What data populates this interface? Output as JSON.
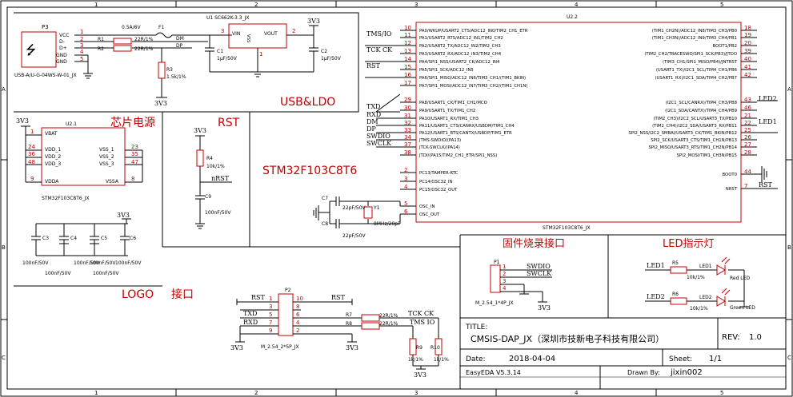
{
  "border": {
    "col_markers": [
      "1",
      "2",
      "3",
      "4",
      "5"
    ],
    "row_markers": [
      "A",
      "B",
      "C"
    ]
  },
  "usb": {
    "connector_ref": "P3",
    "connector_part": "USB-A/U-G-04WS-W-01_JX",
    "pins": [
      "VCC",
      "D-",
      "D+",
      "GND",
      "GND"
    ],
    "pin_numbers": [
      "1",
      "2",
      "3",
      "4",
      "5"
    ],
    "fuse_ref": "F1",
    "fuse_value": "0.5A/6V",
    "r1_ref": "R1",
    "r1_value": "22R/1%",
    "r2_ref": "R2",
    "r2_value": "22R/1%",
    "r3_ref": "R3",
    "r3_value": "1.5k/1%",
    "net_dm": "DM",
    "net_dp": "DP",
    "r3_power": "3V3",
    "reg_ref": "U1 SC662K-3.3_JX",
    "reg_vin": "VIN",
    "reg_vout": "VOUT",
    "reg_vss": "VSS",
    "reg_pin_vin": "3",
    "reg_pin_vout": "2",
    "reg_pin_vss": "1",
    "reg_out_power": "3V3",
    "c1_ref": "C1",
    "c1_value": "1µF/50V",
    "c2_ref": "C2",
    "c2_value": "1µF/50V",
    "block_label": "USB&LDO"
  },
  "mcu_power": {
    "ref": "U2.1",
    "title": "芯片电源",
    "power": "3V3",
    "vbat": "VBAT",
    "vbat_pin": "1",
    "vdd_labels": [
      "VDD_1",
      "VDD_2",
      "VDD_3"
    ],
    "vdd_pins": [
      "24",
      "36",
      "48"
    ],
    "vss_labels": [
      "VSS_1",
      "VSS_2",
      "VSS_3"
    ],
    "vss_pins": [
      "23",
      "35",
      "47"
    ],
    "vdda": "VDDA",
    "vdda_pin": "9",
    "vssa": "VSSA",
    "vssa_pin": "8",
    "part": "STM32F103C8T6_JX",
    "cap_power": "3V3",
    "caps": [
      "C3",
      "C4",
      "C5",
      "C6"
    ],
    "cap_values": [
      "100nF/50V",
      "100nF/50V",
      "100nF/50V",
      "100nF/50V",
      "100nF/50V",
      "100nF/50V"
    ]
  },
  "reset": {
    "title": "RST",
    "power": "3V3",
    "r_ref": "R4",
    "r_value": "10k/1%",
    "net": "nRST",
    "c_ref": "C9",
    "c_value": "100nF/50V"
  },
  "crystal": {
    "c7_ref": "C7",
    "c7_value": "22pF/50V",
    "c8_ref": "C8",
    "c8_value": "22pF/50V",
    "y_ref": "Y1",
    "y_value": "8MHz/20pF"
  },
  "mcu_main": {
    "title": "STM32F103C8T6",
    "ref": "U2.2",
    "part": "STM32F103C8T6_JX",
    "left_pins": [
      {
        "num": "10",
        "label": "PA0/WKUP/USART2_CTS/ADC12_IN0/TIM2_CH1_ETR",
        "net": ""
      },
      {
        "num": "11",
        "label": "PA1/USART2_RTS/ADC12_IN1/TIM2_CH2",
        "net": "TMS/IO"
      },
      {
        "num": "12",
        "label": "PA2/USART2_TX/ADC12_IN2/TIM2_CH3",
        "net": ""
      },
      {
        "num": "13",
        "label": "PA3/USART2_RX/ADC12_IN3/TIM2_CH4",
        "net": "TCK CK"
      },
      {
        "num": "14",
        "label": "PA4/SPI1_NSS/USART2_CK/ADC12_IN4",
        "net": ""
      },
      {
        "num": "15",
        "label": "PA5/SPI1_SCK/ADC12_IN5",
        "net": "RST"
      },
      {
        "num": "16",
        "label": "PA6/SPI1_MISO/ADC12_IN6/TIM3_CH1/(TIM1_BKIN)",
        "net": ""
      },
      {
        "num": "17",
        "label": "PA7/SPI1_MOSI/ADC12_IN7/TIM3_CH2/(TIM1_CH1N)",
        "net": ""
      },
      {
        "num": "29",
        "label": "PA8/USART1_CK/TIM1_CH1/MCO",
        "net": ""
      },
      {
        "num": "30",
        "label": "PA9/USART1_TX/TIM1_CH2",
        "net": "TXD"
      },
      {
        "num": "31",
        "label": "PA10/USART1_RX/TIM1_CH3",
        "net": "RXD"
      },
      {
        "num": "32",
        "label": "PA11/USART1_CTS/CANRX/USBDM/TIM1_CH4",
        "net": "DM"
      },
      {
        "num": "33",
        "label": "PA12/USART1_RTS/CANTX/USBDP/TIM1_ETR",
        "net": "DP"
      },
      {
        "num": "34",
        "label": "JTMS-SWDIO/(PA13)",
        "net": "SWDIO"
      },
      {
        "num": "37",
        "label": "JTCK-SWCLK/(PA14)",
        "net": "SWCLK"
      },
      {
        "num": "38",
        "label": "JTDI/(PA15/TIM2_CH1_ETR/SPI1_NSS)",
        "net": ""
      },
      {
        "num": "2",
        "label": "PC13/TAMPER-RTC",
        "net": ""
      },
      {
        "num": "3",
        "label": "PC14/OSC32_IN",
        "net": ""
      },
      {
        "num": "4",
        "label": "PC15/OSC32_OUT",
        "net": ""
      },
      {
        "num": "5",
        "label": "OSC_IN",
        "net": ""
      },
      {
        "num": "6",
        "label": "OSC_OUT",
        "net": ""
      }
    ],
    "right_pins": [
      {
        "num": "18",
        "label": "(TIM1_CH2N)/ADC12_IN8/TIM3_CH3/PB0",
        "net": ""
      },
      {
        "num": "19",
        "label": "(TIM1_CH3N)/ADC12_IN9/TIM3_CH4/PB1",
        "net": ""
      },
      {
        "num": "20",
        "label": "BOOT1/PB2",
        "net": ""
      },
      {
        "num": "39",
        "label": "(TIM2_CH2/TRACESWO/SPI1_SCK/PB3)/JTDO",
        "net": ""
      },
      {
        "num": "40",
        "label": "(TIM3_CH1/SPI1_MISO/PB4)/JNTRST",
        "net": ""
      },
      {
        "num": "41",
        "label": "(USART1_TX)/I2C1_SCL/TIM4_CH1/PB6",
        "net": ""
      },
      {
        "num": "42",
        "label": "(USART1_RX)/I2C1_SDA/TIM4_CH2/PB7",
        "net": ""
      },
      {
        "num": "43",
        "label": "(I2C1_SCL/CANRX)/TIM4_CH3/PB8",
        "net": "LED2"
      },
      {
        "num": "46",
        "label": "(I2C1_SDA/CANTX)/TIM4_CH4/PB9",
        "net": ""
      },
      {
        "num": "21",
        "label": "(TIM2_CH3)/I2C2_SCL/USART3_TX/PB10",
        "net": ""
      },
      {
        "num": "22",
        "label": "(TIM2_CH4)/I2C2_SDA/USART3_RX/PB11",
        "net": "LED1"
      },
      {
        "num": "25",
        "label": "SPI2_NSS/I2C2_SMBAI/USART3_CK/TIM1_BKIN/PB12",
        "net": ""
      },
      {
        "num": "26",
        "label": "SPI2_SCK/USART3_CTS/TIM1_CH1N/PB13",
        "net": ""
      },
      {
        "num": "27",
        "label": "SPI2_MISO/USART3_RTS/TIM1_CH2N/PB14",
        "net": ""
      },
      {
        "num": "28",
        "label": "SPI2_MOSI/TIM1_CH3N/PB15",
        "net": ""
      },
      {
        "num": "44",
        "label": "BOOT0",
        "net": ""
      },
      {
        "num": "7",
        "label": "NRST",
        "net": "RST"
      }
    ]
  },
  "flash_port": {
    "title": "固件烧录接口",
    "ref": "P1",
    "pin_numbers": [
      "1",
      "2",
      "3",
      "4"
    ],
    "nets": [
      "SWDIO",
      "SWCLK"
    ],
    "part": "M_2.54_1*4P_JX",
    "power": "3V3"
  },
  "led": {
    "title": "LED指示灯",
    "led1_net": "LED1",
    "r5_ref": "R5",
    "r5_value": "10k/1%",
    "led1_ref": "LED1",
    "led1_color": "Red LED",
    "led2_net": "LED2",
    "r6_ref": "R6",
    "r6_value": "10k/1%",
    "led2_ref": "LED2",
    "led2_color": "Green LED"
  },
  "logo": {
    "title": "LOGO"
  },
  "iface": {
    "title": "接口",
    "ref": "P2",
    "part": "M_2.54_2*5P_JX",
    "left_nets": [
      "RST",
      "TXD",
      "RXD"
    ],
    "left_pins": [
      "1",
      "3",
      "5",
      "7",
      "9"
    ],
    "right_pins": [
      "10",
      "8",
      "6",
      "4",
      "2"
    ],
    "power": "3V3",
    "power2": "3V3",
    "r7_ref": "R7",
    "r7_value": "22R/1%",
    "r8_ref": "R8",
    "r8_value": "22R/1%",
    "net_tck": "TCK CK",
    "net_tms": "TMS IO",
    "r9_ref": "R9",
    "r9_value": "1k/1%",
    "r10_ref": "R10",
    "r10_value": "1k/1%",
    "bottom_power": "3V3"
  },
  "title_block": {
    "title_label": "TITLE:",
    "title_value": "CMSIS-DAP_JX（深圳市技新电子科技有限公司）",
    "rev_label": "REV:",
    "rev_value": "1.0",
    "date_label": "Date:",
    "date_value": "2018-04-04",
    "sheet_label": "Sheet:",
    "sheet_value": "1/1",
    "tool": "EasyEDA V5.3.14",
    "drawn_label": "Drawn By:",
    "drawn_value": "jixin002"
  }
}
